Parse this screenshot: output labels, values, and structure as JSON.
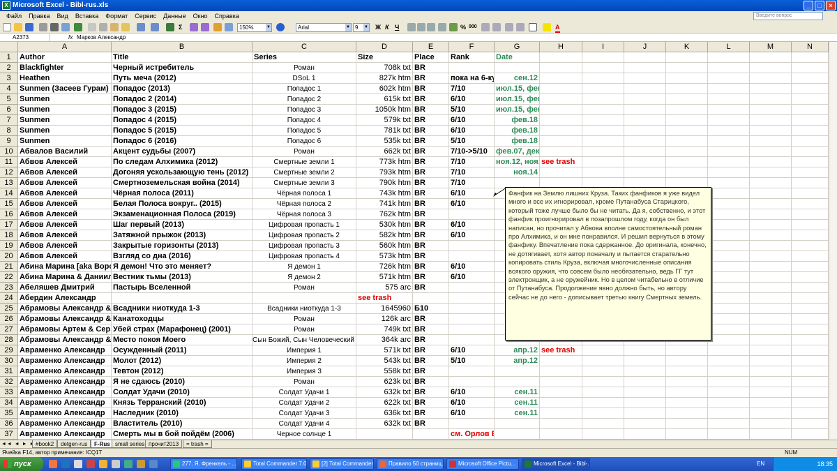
{
  "window": {
    "title": "Microsoft Excel - Bibl-rus.xls"
  },
  "menu": [
    "Файл",
    "Правка",
    "Вид",
    "Вставка",
    "Формат",
    "Сервис",
    "Данные",
    "Окно",
    "Справка"
  ],
  "help_placeholder": "Введите вопрос",
  "toolbar": {
    "zoom": "150%",
    "font": "Arial",
    "size": "9"
  },
  "formula": {
    "cell": "A2373",
    "fx": "fx",
    "content": "Марков Александр"
  },
  "columns": [
    "A",
    "B",
    "C",
    "D",
    "E",
    "F",
    "G",
    "H",
    "I",
    "J",
    "K",
    "L",
    "M",
    "N"
  ],
  "rows": [
    {
      "n": "1",
      "a": "Author",
      "b": "Title",
      "c": "Series",
      "d": "Size",
      "e": "Place",
      "f": "Rank",
      "g": "Date",
      "h": ""
    },
    {
      "n": "2",
      "a": "Blackfighter",
      "b": "Черный истребитель",
      "c": "Роман",
      "d": "708k txt",
      "e": "BR",
      "f": "",
      "g": "",
      "h": ""
    },
    {
      "n": "3",
      "a": "Heathen",
      "b": "Путь меча (2012)",
      "c": "DSoL 1",
      "d": "827k htm",
      "e": "BR",
      "f": "пока на 6-ку",
      "g": "сен.12",
      "h": ""
    },
    {
      "n": "4",
      "a": "Sunmen (Засеев Гурам)",
      "b": "Попадос (2013)",
      "c": "Попадос 1",
      "d": "602k htm",
      "e": "BR",
      "f": "7/10",
      "g": "июл.15, фев.18",
      "h": ""
    },
    {
      "n": "5",
      "a": "Sunmen",
      "b": "Попадос 2 (2014)",
      "c": "Попадос 2",
      "d": "615k txt",
      "e": "BR",
      "f": "6/10",
      "g": "июл.15, фев.18",
      "h": ""
    },
    {
      "n": "6",
      "a": "Sunmen",
      "b": "Попадос 3 (2015)",
      "c": "Попадос 3",
      "d": "1050k htm",
      "e": "BR",
      "f": "5/10",
      "g": "июл.15, фев.18",
      "h": ""
    },
    {
      "n": "7",
      "a": "Sunmen",
      "b": "Попадос 4 (2015)",
      "c": "Попадос 4",
      "d": "579k txt",
      "e": "BR",
      "f": "6/10",
      "g": "фев.18",
      "h": ""
    },
    {
      "n": "8",
      "a": "Sunmen",
      "b": "Попадос 5 (2015)",
      "c": "Попадос 5",
      "d": "781k txt",
      "e": "BR",
      "f": "6/10",
      "g": "фев.18",
      "h": ""
    },
    {
      "n": "9",
      "a": "Sunmen",
      "b": "Попадос 6 (2016)",
      "c": "Попадос 6",
      "d": "535k txt",
      "e": "BR",
      "f": "5/10",
      "g": "фев.18",
      "h": ""
    },
    {
      "n": "10",
      "a": "Абвалов Василий",
      "b": "Акцент судьбы (2007)",
      "c": "Роман",
      "d": "662k txt",
      "e": "BR",
      "f": "7/10->5/10",
      "g": "фев.07, дек.16",
      "h": ""
    },
    {
      "n": "11",
      "a": "Абвов Алексей",
      "b": "По следам Алхимика (2012)",
      "c": "Смертные земли 1",
      "d": "773k htm",
      "e": "BR",
      "f": "7/10",
      "g": "ноя.12, ноя.",
      "h": "see trash"
    },
    {
      "n": "12",
      "a": "Абвов Алексей",
      "b": "Догоняя ускользающую тень (2012)",
      "c": "Смертные земли 2",
      "d": "793k htm",
      "e": "BR",
      "f": "7/10",
      "g": "ноя.14",
      "h": ""
    },
    {
      "n": "13",
      "a": "Абвов Алексей",
      "b": "Смертноземельская война (2014)",
      "c": "Смертные земли 3",
      "d": "790k htm",
      "e": "BR",
      "f": "7/10",
      "g": "",
      "h": ""
    },
    {
      "n": "14",
      "a": "Абвов Алексей",
      "b": "Чёрная полоса (2011)",
      "c": "Чёрная полоса 1",
      "d": "743k htm",
      "e": "BR",
      "f": "6/10",
      "g": "ап",
      "h": ""
    },
    {
      "n": "15",
      "a": "Абвов Алексей",
      "b": "Белая Полоса вокруг.. (2015)",
      "c": "Чёрная полоса 2",
      "d": "741k htm",
      "e": "BR",
      "f": "6/10",
      "g": "",
      "h": ""
    },
    {
      "n": "16",
      "a": "Абвов Алексей",
      "b": "Экзаменационная Полоса (2019)",
      "c": "Чёрная полоса 3",
      "d": "762k htm",
      "e": "BR",
      "f": "",
      "g": "",
      "h": ""
    },
    {
      "n": "17",
      "a": "Абвов Алексей",
      "b": "Шаг первый (2013)",
      "c": "Цифровая пропасть 1",
      "d": "530k htm",
      "e": "BR",
      "f": "6/10",
      "g": "",
      "h": ""
    },
    {
      "n": "18",
      "a": "Абвов Алексей",
      "b": "Затяжной прыжок (2013)",
      "c": "Цифровая пропасть 2",
      "d": "582k htm",
      "e": "BR",
      "f": "6/10",
      "g": "",
      "h": ""
    },
    {
      "n": "19",
      "a": "Абвов Алексей",
      "b": "Закрытые горизонты (2013)",
      "c": "Цифровая пропасть 3",
      "d": "560k htm",
      "e": "BR",
      "f": "",
      "g": "",
      "h": ""
    },
    {
      "n": "20",
      "a": "Абвов Алексей",
      "b": "Взгляд со дна (2016)",
      "c": "Цифровая пропасть 4",
      "d": "573k htm",
      "e": "BR",
      "f": "",
      "g": "",
      "h": ""
    },
    {
      "n": "21",
      "a": "Абина Марина [aka Ворон]",
      "b": "Я демон! Что это меняет?",
      "c": "Я демон 1",
      "d": "726k htm",
      "e": "BR",
      "f": "6/10",
      "g": "",
      "h": ""
    },
    {
      "n": "22",
      "a": "Абина Марина & Даниил",
      "b": "Вестник тьмы (2013)",
      "c": "Я демон 2",
      "d": "571k htm",
      "e": "BR",
      "f": "6/10",
      "g": "",
      "h": ""
    },
    {
      "n": "23",
      "a": "Абеляшев Дмитрий",
      "b": "Пастырь Вселенной",
      "c": "Роман",
      "d": "575 arc",
      "e": "BR",
      "f": "",
      "g": "",
      "h": ""
    },
    {
      "n": "24",
      "a": "Абердин Александр",
      "b": "",
      "c": "",
      "d": "see trash",
      "e": "",
      "f": "",
      "g": "",
      "h": ""
    },
    {
      "n": "25",
      "a": "Абрамовы Александр & С",
      "b": "Всадники ниоткуда 1-3",
      "c": "Всадники ниоткуда 1-3",
      "d": "1645960",
      "e": "Б10",
      "f": "",
      "g": "",
      "h": ""
    },
    {
      "n": "26",
      "a": "Абрамовы Александр & С",
      "b": "Канатоходцы",
      "c": "Роман",
      "d": "126k arc",
      "e": "BR",
      "f": "",
      "g": "",
      "h": ""
    },
    {
      "n": "27",
      "a": "Абрамовы Артем & Серге",
      "b": "Убей страх (Марафонец) (2001)",
      "c": "Роман",
      "d": "749k txt",
      "e": "BR",
      "f": "",
      "g": "",
      "h": ""
    },
    {
      "n": "28",
      "a": "Абрамовы Александр & С",
      "b": "Место покоя Моего",
      "c": "Сын Божий, Сын Человеческий 1",
      "d": "364k arc",
      "e": "BR",
      "f": "",
      "g": "",
      "h": "see trash"
    },
    {
      "n": "29",
      "a": "Авраменко Александр",
      "b": "Осужденный (2011)",
      "c": "Империя 1",
      "d": "571k txt",
      "e": "BR",
      "f": "6/10",
      "g": "апр.12",
      "h": "see trash"
    },
    {
      "n": "30",
      "a": "Авраменко Александр",
      "b": "Молот (2012)",
      "c": "Империя 2",
      "d": "543k txt",
      "e": "BR",
      "f": "5/10",
      "g": "апр.12",
      "h": ""
    },
    {
      "n": "31",
      "a": "Авраменко Александр",
      "b": "Тевтон (2012)",
      "c": "Империя 3",
      "d": "558k txt",
      "e": "BR",
      "f": "",
      "g": "",
      "h": ""
    },
    {
      "n": "32",
      "a": "Авраменко Александр",
      "b": "Я не сдаюсь (2010)",
      "c": "Роман",
      "d": "623k txt",
      "e": "BR",
      "f": "",
      "g": "",
      "h": ""
    },
    {
      "n": "33",
      "a": "Авраменко Александр",
      "b": "Солдат Удачи (2010)",
      "c": "Солдат Удачи 1",
      "d": "632k txt",
      "e": "BR",
      "f": "6/10",
      "g": "сен.11",
      "h": ""
    },
    {
      "n": "34",
      "a": "Авраменко Александр",
      "b": "Князь Терранский (2010)",
      "c": "Солдат Удачи 2",
      "d": "622k txt",
      "e": "BR",
      "f": "6/10",
      "g": "сен.11",
      "h": ""
    },
    {
      "n": "35",
      "a": "Авраменко Александр",
      "b": "Наследник (2010)",
      "c": "Солдат Удачи 3",
      "d": "636k txt",
      "e": "BR",
      "f": "6/10",
      "g": "сен.11",
      "h": ""
    },
    {
      "n": "36",
      "a": "Авраменко Александр",
      "b": "Властитель (2010)",
      "c": "Солдат Удачи 4",
      "d": "632k txt",
      "e": "BR",
      "f": "",
      "g": "",
      "h": ""
    },
    {
      "n": "37",
      "a": "Авраменко Александр",
      "b": "Смерть мы в бой пойдём (2006)",
      "c": "Черное солнце 1",
      "d": "",
      "e": "",
      "f": "см. Орлов Борис",
      "g": "",
      "h": ""
    }
  ],
  "note": "Фанфик на Землю лишних Круза. Таких фанфиков я уже видел много и все их игнорировал, кроме Путанабуса Старицкого, который тоже лучше было бы не читать. Да я, собственно, и этот фанфик проигнорировал в позапрошлом году, когда он был написан, но прочитал у Абвова вполне самостоятельный роман про Алхимика, и он мне понравился. И решил вернуться в этому фанфику. Впечатление пока сдержанное. До оригинала, конечно, не дотягивает, хотя автор поначалу и пытается старательно копировать стиль Круза, включая многочисленные описания всякого оружия, что совсем было необязательно, ведь ГГ тут электронщик, а не оружейник. Но в целом читабельно в отличие от Путанабуса. Продолжение явно должно быть, но автору сейчас не до него - дописывает третью книгу Смертных земель.",
  "sheet_tabs": [
    "#book2",
    "detgen-rus",
    "F-Rus",
    "small series",
    "прочит2013",
    "= trash ="
  ],
  "active_tab": "F-Rus",
  "status": {
    "left": "Ячейка F14, автор примечания: ICQ1T",
    "num": "NUM"
  },
  "taskbar": {
    "start": "пуск",
    "tasks": [
      "277. Я. Френкель - ...",
      "Total Commander 7.0...",
      "[2] Total Commander ...",
      "Правило 50 страниц...",
      "Microsoft Office Pictu...",
      "Microsoft Excel - Bibl-..."
    ],
    "lang": "EN",
    "clock": "18:35"
  }
}
